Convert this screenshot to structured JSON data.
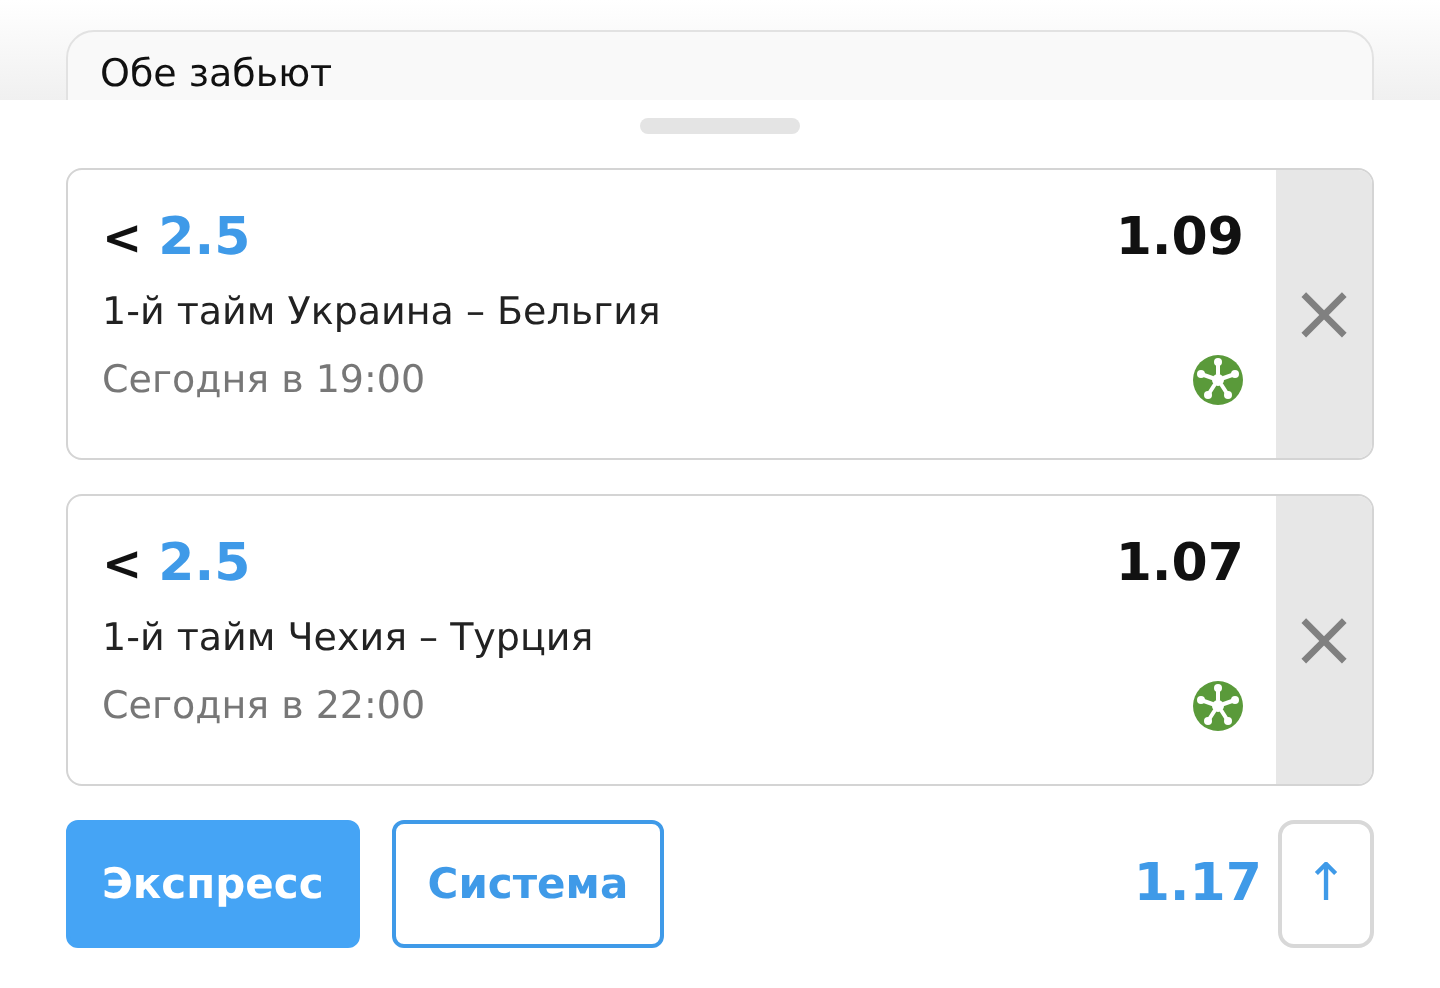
{
  "background_card": {
    "title": "Обе забьют"
  },
  "bets": [
    {
      "sign": "<",
      "line": "2.5",
      "odds": "1.09",
      "match": "1-й тайм Украина – Бельгия",
      "time": "Сегодня в 19:00",
      "remove": "×"
    },
    {
      "sign": "<",
      "line": "2.5",
      "odds": "1.07",
      "match": "1-й тайм Чехия – Турция",
      "time": "Сегодня в 22:00",
      "remove": "×"
    }
  ],
  "bet_types": [
    {
      "label": "Экспресс",
      "selected": true
    },
    {
      "label": "Система",
      "selected": false
    }
  ],
  "total_odds": "1.17",
  "expand_button": "↑"
}
